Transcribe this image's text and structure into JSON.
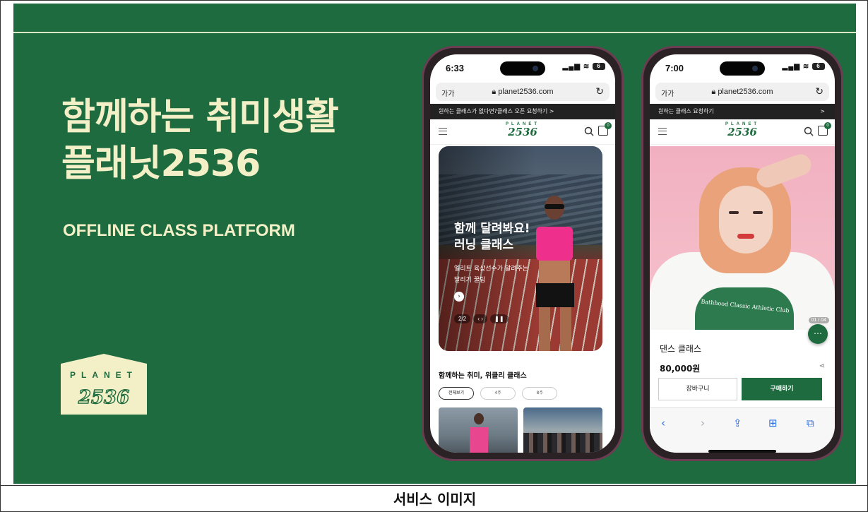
{
  "banner": {
    "headline_line1": "함께하는 취미생활",
    "headline_line2": "플래닛2536",
    "subline": "OFFLINE CLASS PLATFORM",
    "logo_word": "PLANET",
    "logo_number": "2536"
  },
  "colors": {
    "brand_green": "#1e6b3f",
    "headline_cream": "#f3f0c8"
  },
  "phone1": {
    "time": "6:33",
    "battery": "6",
    "url_aa": "가가",
    "url": "planet2536.com",
    "promo_text": "원하는 클래스가 없다면?클래스 오픈 요청하기 >",
    "logo_word": "PLANET",
    "logo_number": "2536",
    "cart_count": "0",
    "hero_title_line1": "함께 달려봐요!",
    "hero_title_line2": "러닝 클래스",
    "hero_sub_line1": "엘리트 육상선수가 알려주는",
    "hero_sub_line2": "달리기 꿀팁",
    "hero_counter": "2/2",
    "section_title": "함께하는 취미, 위클리 클래스",
    "chips": [
      "전체보기",
      "4주",
      "8주"
    ]
  },
  "phone2": {
    "time": "7:00",
    "battery": "6",
    "url_aa": "가가",
    "url": "planet2536.com",
    "promo_text": "원하는 클래스 요청하기",
    "promo_arrow": ">",
    "logo_word": "PLANET",
    "logo_number": "2536",
    "cart_count": "0",
    "slide_counter": "01 / 04",
    "shirt_text": "Bathhood Classic Athletic Club",
    "product_name": "댄스 클래스",
    "price": "80,000원",
    "cart_button": "장바구니",
    "buy_button": "구매하기"
  },
  "caption": "서비스 이미지",
  "icons": [
    "menu-icon",
    "search-icon",
    "bag-icon",
    "reload-icon",
    "lock-icon",
    "chat-icon",
    "share-icon",
    "back-icon",
    "forward-icon",
    "share-sheet-icon",
    "bookmarks-icon",
    "tabs-icon"
  ]
}
